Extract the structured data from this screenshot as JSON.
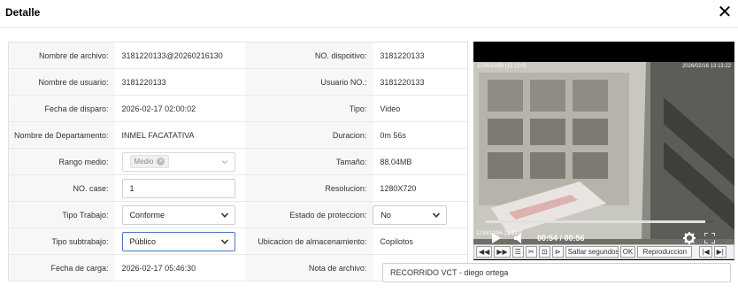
{
  "dialog": {
    "title": "Detalle"
  },
  "rows": [
    {
      "l1": "Nombre de archivo:",
      "v1": "3181220133@20260216130",
      "l2": "NO. dispoitivo:",
      "v2": "3181220133"
    },
    {
      "l1": "Nombre de usuario:",
      "v1": "3181220133",
      "l2": "Usuario NO.:",
      "v2": "3181220133"
    },
    {
      "l1": "Fecha de disparo:",
      "v1": "2026-02-17 02:00:02",
      "l2": "Tipo:",
      "v2": "Video"
    },
    {
      "l1": "Nombre de Departamento:",
      "v1": "INMEL FACATATIVA",
      "l2": "Duracion:",
      "v2": "0m 56s"
    },
    {
      "l1": "Rango medio:",
      "v1": "Medio",
      "l2": "Tamaño:",
      "v2": "88.04MB"
    },
    {
      "l1": "NO. case:",
      "v1": "1",
      "l2": "Resolucion:",
      "v2": "1280X720"
    },
    {
      "l1": "Tipo Trabajo:",
      "v1": "Conforme",
      "l2": "Estado de proteccion:",
      "v2": "No"
    },
    {
      "l1": "Tipo subtrabajo:",
      "v1": "Público",
      "l2": "Ubicacion de almacenamiento:",
      "v2": "Copilotos"
    },
    {
      "l1": "Fecha de carga:",
      "v1": "2026-02-17 05:46:30",
      "l2": "Nota de archivo:",
      "v2": "RECORRIDO VCT - diego ortega"
    }
  ],
  "player": {
    "ts_left": "1234/12/56 (12:12:0)",
    "ts_right": "2026/02/16 13:13:22",
    "ts_bottom": "1234/12/56 12:12:0",
    "current_time": "00:54",
    "duration": "00:56",
    "time_display": "00:54 / 00:56",
    "progress": 0.96
  },
  "toolbar": {
    "buttons": [
      "◀◀",
      "▶▶",
      "☰",
      "✂",
      "⊡",
      "⊳"
    ],
    "saltar_label": "Saltar segundos",
    "ok_label": "OK",
    "repro_label": "Reproduccion",
    "end_buttons": [
      "|◀",
      "▶|"
    ]
  },
  "colors": {
    "focus_border": "#4a78c2",
    "label_bg": "#f7f7f7"
  }
}
